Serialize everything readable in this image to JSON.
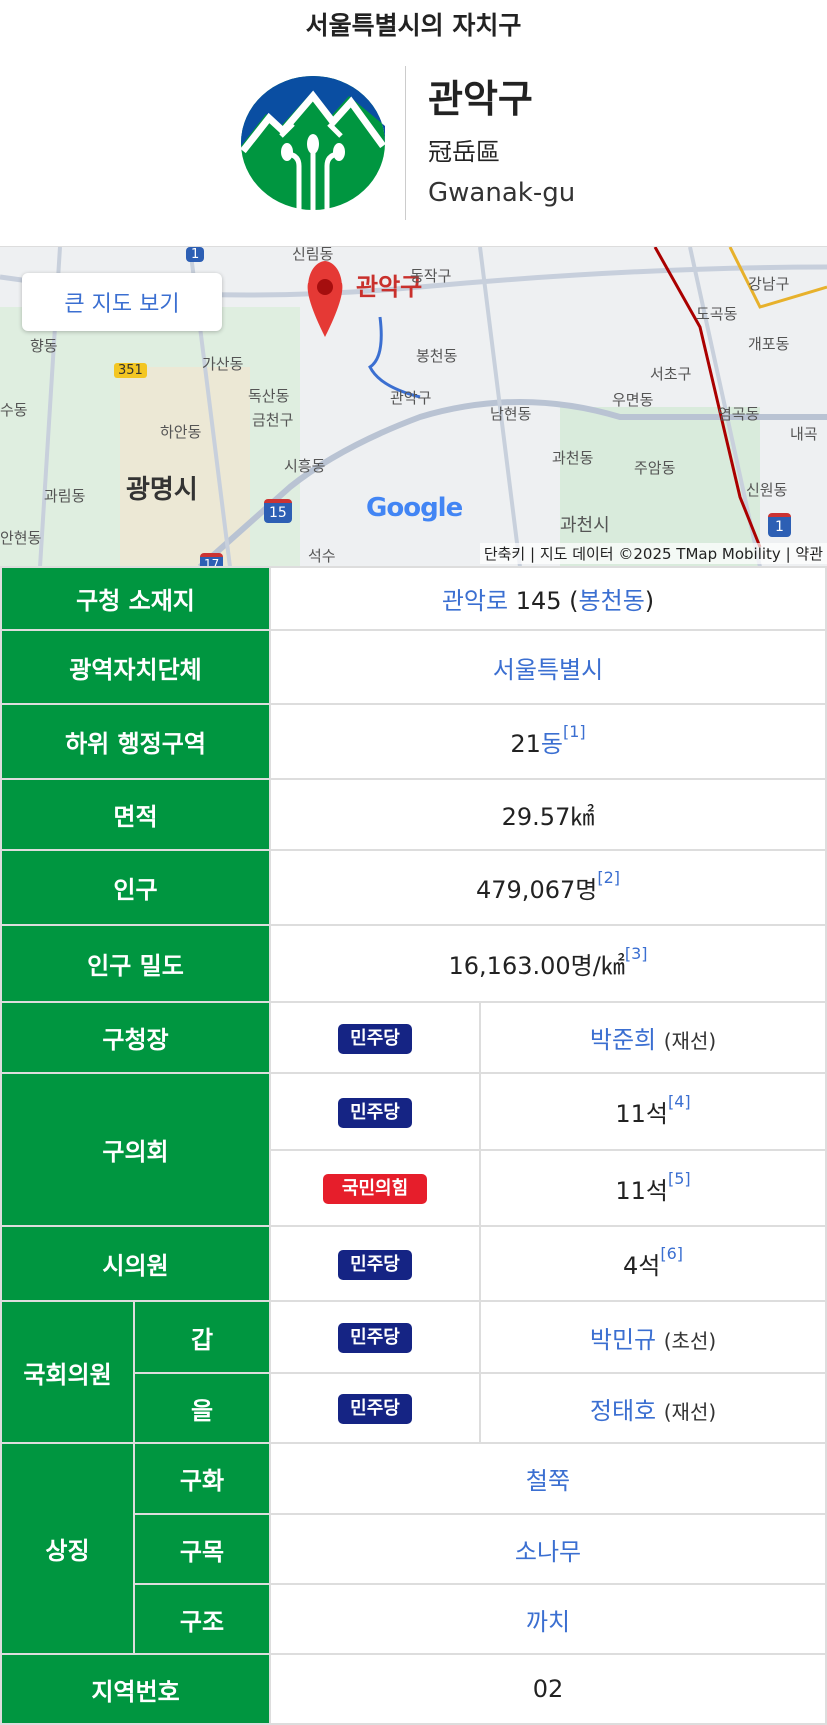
{
  "header": {
    "title": "서울특별시의 자치구",
    "name_ko": "관악구",
    "name_hanja": "冠岳區",
    "name_en": "Gwanak-gu"
  },
  "map": {
    "big_map_button": "큰 지도 보기",
    "pin_label": "관악구",
    "labels": [
      "신림동",
      "동작구",
      "강남구",
      "도곡동",
      "개포동",
      "봉천동",
      "서초구",
      "우면동",
      "염곡동",
      "내곡",
      "가산동",
      "독산동",
      "금천구",
      "관악구",
      "남현동",
      "향동",
      "하안동",
      "수동",
      "시흥동",
      "과천동",
      "주암동",
      "광명시",
      "과림동",
      "신원동",
      "과천시",
      "안현동",
      "석수"
    ],
    "road_shields": [
      "1",
      "351",
      "15",
      "1",
      "17"
    ],
    "google": "Google",
    "attribution": {
      "shortcuts": "단축키",
      "data": "지도 데이터 ©2025 TMap Mobility",
      "terms": "약관"
    }
  },
  "table": {
    "office_label": "구청 소재지",
    "office_road": "관악로",
    "office_num": " 145 (",
    "office_dong": "봉천동",
    "office_close": ")",
    "metro_label": "광역자치단체",
    "metro_value": "서울특별시",
    "sub_label": "하위 행정구역",
    "sub_num": "21",
    "sub_unit": "동",
    "sub_ref": "[1]",
    "area_label": "면적",
    "area_value": "29.57㎢",
    "pop_label": "인구",
    "pop_value": "479,067명",
    "pop_ref": "[2]",
    "density_label": "인구 밀도",
    "density_value": "16,163.00명/㎢",
    "density_ref": "[3]",
    "mayor_label": "구청장",
    "mayor_party": "민주당",
    "mayor_name": "박준희",
    "mayor_note": "(재선)",
    "council_label": "구의회",
    "council": [
      {
        "party": "민주당",
        "seats": "11석",
        "ref": "[4]"
      },
      {
        "party": "국민의힘",
        "seats": "11석",
        "ref": "[5]"
      }
    ],
    "city_label": "시의원",
    "city_party": "민주당",
    "city_seats": "4석",
    "city_ref": "[6]",
    "na_label": "국회의원",
    "na": [
      {
        "district": "갑",
        "party": "민주당",
        "name": "박민규",
        "note": "(초선)"
      },
      {
        "district": "을",
        "party": "민주당",
        "name": "정태호",
        "note": "(재선)"
      }
    ],
    "symbol_label": "상징",
    "symbols": [
      {
        "kind": "구화",
        "value": "철쭉"
      },
      {
        "kind": "구목",
        "value": "소나무"
      },
      {
        "kind": "구조",
        "value": "까치"
      }
    ],
    "code_label": "지역번호",
    "code_value": "02"
  },
  "colors": {
    "header_green": "#009640",
    "link": "#3b6fd1",
    "dem": "#152484",
    "ppp": "#e61e2b"
  }
}
